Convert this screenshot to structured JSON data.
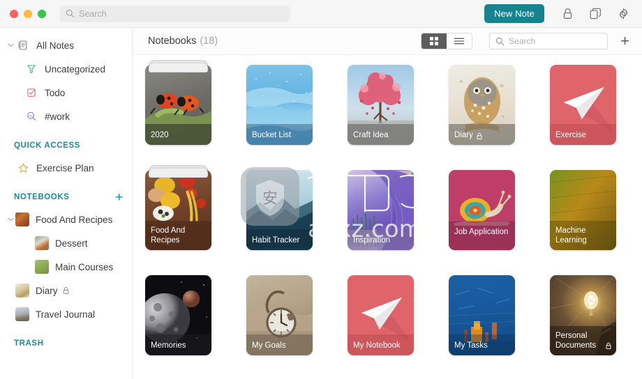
{
  "titlebar": {
    "search_placeholder": "Search",
    "new_note_label": "New Note",
    "icons": [
      "lock-icon",
      "duplicate-icon",
      "gear-icon"
    ]
  },
  "sidebar": {
    "all_notes": {
      "label": "All Notes",
      "icon": "notes-icon"
    },
    "all_notes_children": [
      {
        "label": "Uncategorized",
        "icon": "funnel-icon"
      },
      {
        "label": "Todo",
        "icon": "checkbox-icon"
      },
      {
        "label": "#work",
        "icon": "tag-search-icon"
      }
    ],
    "quick_access": {
      "title": "QUICK ACCESS",
      "items": [
        {
          "label": "Exercise Plan",
          "icon": "star-icon"
        }
      ]
    },
    "notebooks": {
      "title": "NOTEBOOKS",
      "add_label": "+",
      "items": [
        {
          "label": "Food And Recipes",
          "level": 1,
          "expandable": true,
          "locked": false
        },
        {
          "label": "Dessert",
          "level": 2,
          "expandable": false,
          "locked": false
        },
        {
          "label": "Main Courses",
          "level": 2,
          "expandable": false,
          "locked": false
        },
        {
          "label": "Diary",
          "level": 1,
          "expandable": false,
          "locked": true
        },
        {
          "label": "Travel Journal",
          "level": 1,
          "expandable": false,
          "locked": false
        }
      ]
    },
    "trash": {
      "title": "TRASH"
    }
  },
  "main": {
    "title": "Notebooks",
    "count": "(18)",
    "view_grid_label": "grid-view",
    "view_list_label": "list-view",
    "active_view": "grid",
    "search_placeholder": "Search",
    "add_label": "+"
  },
  "notebooks": [
    {
      "name": "2020",
      "stacked": true,
      "locked": false,
      "accent": "#6e6e68"
    },
    {
      "name": "Bucket List",
      "stacked": false,
      "locked": false,
      "accent": "#4d9fd6"
    },
    {
      "name": "Craft Idea",
      "stacked": false,
      "locked": false,
      "accent": "#9b9b98"
    },
    {
      "name": "Diary",
      "stacked": false,
      "locked": true,
      "accent": "#9a958e"
    },
    {
      "name": "Exercise",
      "stacked": false,
      "locked": false,
      "accent": "#e06a72"
    },
    {
      "name": "Food And Recipes",
      "stacked": true,
      "locked": false,
      "accent": "#6b4030"
    },
    {
      "name": "Habit Tracker",
      "stacked": false,
      "locked": false,
      "accent": "#1e3f4f"
    },
    {
      "name": "Inspiration",
      "stacked": false,
      "locked": false,
      "accent": "#7a6fb5"
    },
    {
      "name": "Job Application",
      "stacked": false,
      "locked": false,
      "accent": "#b83c68"
    },
    {
      "name": "Machine Learning",
      "stacked": false,
      "locked": false,
      "accent": "#7e7020"
    },
    {
      "name": "Memories",
      "stacked": false,
      "locked": false,
      "accent": "#1b1b1f"
    },
    {
      "name": "My Goals",
      "stacked": false,
      "locked": false,
      "accent": "#a79585"
    },
    {
      "name": "My Notebook",
      "stacked": false,
      "locked": false,
      "accent": "#e0656b"
    },
    {
      "name": "My Tasks",
      "stacked": false,
      "locked": false,
      "accent": "#1b5e9c"
    },
    {
      "name": "Personal Documents",
      "stacked": false,
      "locked": true,
      "accent": "#4a3a2c"
    }
  ],
  "watermark": {
    "glyph": "安",
    "text": "anxz.com"
  },
  "colors": {
    "accent_teal": "#17838f",
    "section_teal": "#1a8c99",
    "window_bg": "#f6f6f6"
  }
}
